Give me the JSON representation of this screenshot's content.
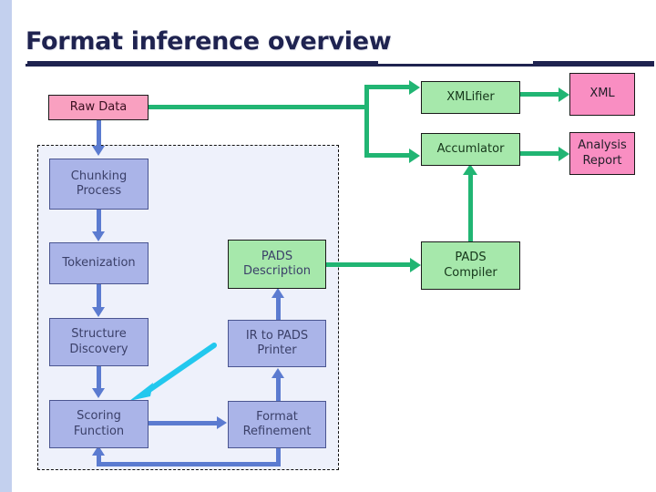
{
  "slide": {
    "title": "Format inference overview"
  },
  "colors": {
    "title_navy": "#1f2350",
    "blue_node": "#aab4e8",
    "green_node": "#a6e8ab",
    "pink_node": "#f9a0c0",
    "blue_arrow": "#5b7bd0",
    "green_arrow": "#21b573",
    "cyan_arrow": "#22c8ee",
    "dashed_region_fill": "#eef1fb",
    "left_band": "#c3d0ee"
  },
  "nodes": {
    "raw_data": {
      "label": "Raw Data",
      "color": "pink"
    },
    "chunking_process": {
      "label": "Chunking\nProcess",
      "line1": "Chunking",
      "line2": "Process",
      "color": "blue"
    },
    "tokenization": {
      "label": "Tokenization",
      "color": "blue"
    },
    "structure_discovery": {
      "line1": "Structure",
      "line2": "Discovery",
      "color": "blue"
    },
    "scoring_function": {
      "line1": "Scoring",
      "line2": "Function",
      "color": "blue"
    },
    "pads_description": {
      "line1": "PADS",
      "line2": "Description",
      "color": "green"
    },
    "ir_to_pads_printer": {
      "line1": "IR to PADS",
      "line2": "Printer",
      "color": "blue"
    },
    "format_refinement": {
      "line1": "Format",
      "line2": "Refinement",
      "color": "blue"
    },
    "xmlifier": {
      "label": "XMLifier",
      "color": "green"
    },
    "accumlator": {
      "label": "Accumlator",
      "color": "green"
    },
    "pads_compiler": {
      "line1": "PADS",
      "line2": "Compiler",
      "color": "green"
    },
    "xml": {
      "label": "XML",
      "color": "pink"
    },
    "analysis_report": {
      "line1": "Analysis",
      "line2": "Report",
      "color": "pink"
    }
  }
}
